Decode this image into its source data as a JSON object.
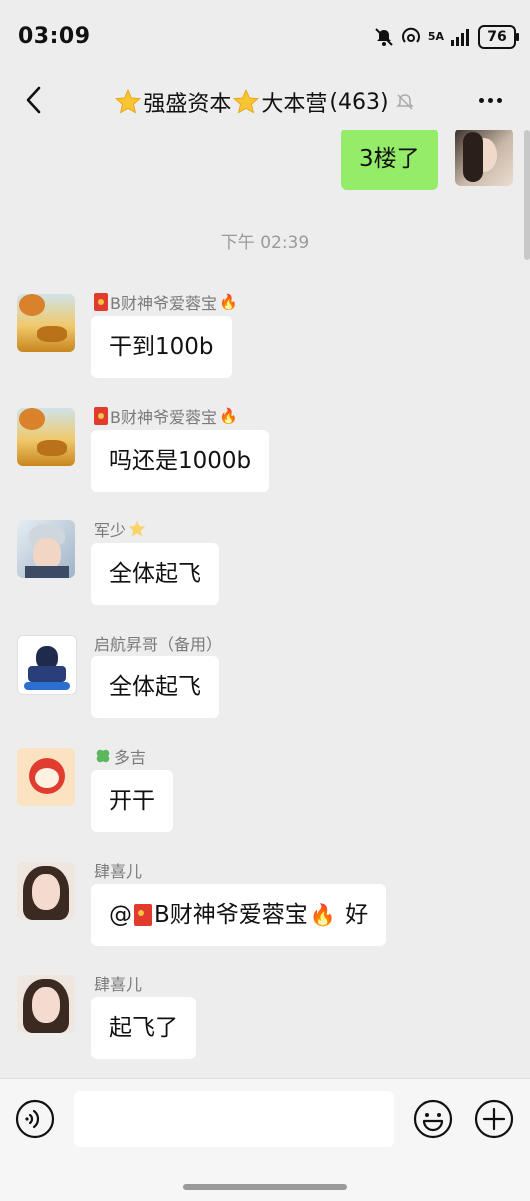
{
  "status": {
    "time": "03:09",
    "network": "5A",
    "battery": "76"
  },
  "header": {
    "title": "强盛资本",
    "title2": "大本营",
    "count": "(463)"
  },
  "messages": [
    {
      "text": "3楼了"
    },
    {
      "sender": "B财神爷爱蓉宝",
      "text": "干到100b"
    },
    {
      "sender": "B财神爷爱蓉宝",
      "text": "吗还是1000b"
    },
    {
      "sender": "军少",
      "text": "全体起飞"
    },
    {
      "sender": "启航昇哥（备用）",
      "text": "全体起飞"
    },
    {
      "sender": "多吉",
      "text": "开干"
    },
    {
      "sender": "肆喜儿",
      "text_prefix": "@",
      "text_mention": "B财神爷爱蓉宝",
      "text_suffix": " 好"
    },
    {
      "sender": "肆喜儿",
      "text": "起飞了"
    }
  ],
  "timestamp": "下午 02:39",
  "icons": {
    "back": "chevron-left-icon",
    "star": "star-icon",
    "mute": "bell-off-icon",
    "more": "more-dots-icon",
    "voice": "voice-icon",
    "emoji": "emoji-icon",
    "plus": "plus-icon",
    "redpacket": "red-packet-icon",
    "fire": "fire-icon",
    "clover": "clover-icon"
  },
  "colors": {
    "my_bubble": "#95ec69",
    "background": "#ededed"
  }
}
